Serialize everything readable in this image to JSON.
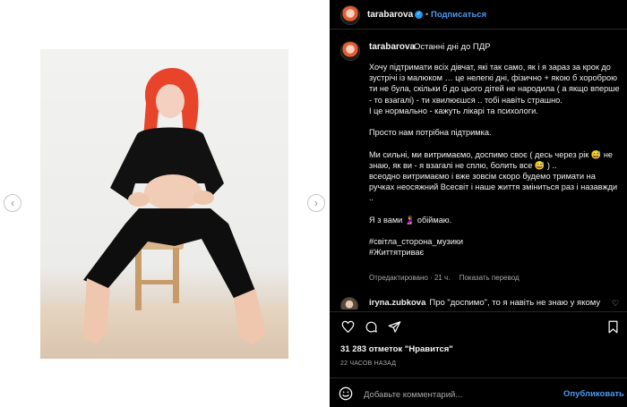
{
  "media": {
    "prev_icon": "chevron-left-icon",
    "next_icon": "chevron-right-icon",
    "prev_glyph": "‹",
    "next_glyph": "›"
  },
  "header": {
    "username": "tarabarova",
    "dot": "•",
    "follow_label": "Подписаться"
  },
  "post": {
    "username": "tarabarova",
    "title": "Останні дні до ПДР ",
    "caption": "Хочу підтримати всіх дівчат, які так само, як і я зараз за крок до зустрічі із малюком … це нелегкі дні, фізично + якою б хороброю ти не була, скільки б до цього дітей не народила ( а якщо вперше - то взагалі) - ти хвилюєшся .. тобі навіть страшно.\nІ це нормально - кажуть лікарі та психологи.\n\nПросто нам потрібна підтримка.\n\nМи сильні, ми витримаємо, доспимо своє ( десь через рік 😅 не знаю, як ви - я взагалі не сплю, болить все 😅 ) ..\nвсеодно витримаємо і вже зовсім скоро будемо тримати на ручках неосяжний Всесвіт і наше життя зміниться раз і назавжди ..\n\nЯ з вами 🤰 обіймаю.\n\n#світла_сторона_музики\n#Життятриває",
    "edited_label": "Отредактировано · 21 ч.",
    "translate_label": "Показать перевод"
  },
  "comment": {
    "username": "iryna.zubkova",
    "text": "Про \"доспимо\", то я навіть не знаю у якому"
  },
  "stats": {
    "likes_label": "31 283 отметок \"Нравится\"",
    "time_label": "22 ЧАСОВ НАЗАД"
  },
  "add_comment": {
    "placeholder": "Добавьте комментарий...",
    "publish_label": "Опубликовать"
  },
  "colors": {
    "panel_bg": "#000000",
    "accent_blue": "#4c9bf0",
    "muted": "#a8a8a8"
  }
}
